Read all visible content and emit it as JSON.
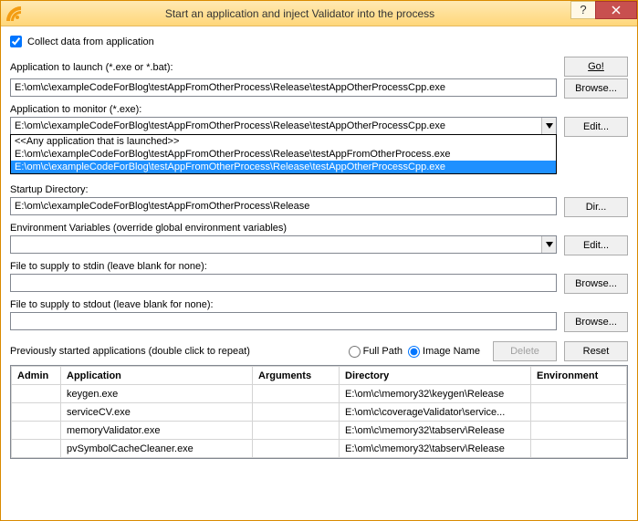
{
  "title": "Start an application and inject Validator into the process",
  "collect_label": "Collect data from application",
  "collect_checked": true,
  "app_launch": {
    "label": "Application to launch (*.exe or *.bat):",
    "value": "E:\\om\\c\\exampleCodeForBlog\\testAppFromOtherProcess\\Release\\testAppOtherProcessCpp.exe"
  },
  "app_monitor": {
    "label": "Application to monitor (*.exe):",
    "value": "E:\\om\\c\\exampleCodeForBlog\\testAppFromOtherProcess\\Release\\testAppOtherProcessCpp.exe",
    "options": [
      "<<Any application that is launched>>",
      "E:\\om\\c\\exampleCodeForBlog\\testAppFromOtherProcess\\Release\\testAppFromOtherProcess.exe",
      "E:\\om\\c\\exampleCodeForBlog\\testAppFromOtherProcess\\Release\\testAppOtherProcessCpp.exe"
    ],
    "selected_index": 2
  },
  "startup_dir": {
    "label": "Startup Directory:",
    "value": "E:\\om\\c\\exampleCodeForBlog\\testAppFromOtherProcess\\Release"
  },
  "env_vars": {
    "label": "Environment Variables (override global environment variables)",
    "value": ""
  },
  "stdin": {
    "label": "File to supply to stdin (leave blank for none):",
    "value": ""
  },
  "stdout": {
    "label": "File to supply to stdout (leave blank for none):",
    "value": ""
  },
  "prev_label": "Previously started applications (double click to repeat)",
  "radio": {
    "full_path": "Full Path",
    "image_name": "Image Name",
    "selected": "image_name"
  },
  "buttons": {
    "go": "Go!",
    "browse": "Browse...",
    "edit": "Edit...",
    "dir": "Dir...",
    "delete": "Delete",
    "reset": "Reset"
  },
  "table": {
    "headers": {
      "admin": "Admin",
      "app": "Application",
      "args": "Arguments",
      "dir": "Directory",
      "env": "Environment"
    },
    "rows": [
      {
        "admin": "",
        "app": "keygen.exe",
        "args": "",
        "dir": "E:\\om\\c\\memory32\\keygen\\Release",
        "env": ""
      },
      {
        "admin": "",
        "app": "serviceCV.exe",
        "args": "",
        "dir": "E:\\om\\c\\coverageValidator\\service...",
        "env": ""
      },
      {
        "admin": "",
        "app": "memoryValidator.exe",
        "args": "",
        "dir": "E:\\om\\c\\memory32\\tabserv\\Release",
        "env": ""
      },
      {
        "admin": "",
        "app": "pvSymbolCacheCleaner.exe",
        "args": "",
        "dir": "E:\\om\\c\\memory32\\tabserv\\Release",
        "env": ""
      }
    ]
  }
}
